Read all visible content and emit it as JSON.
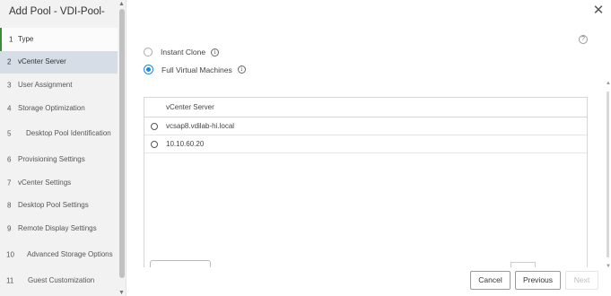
{
  "dialog": {
    "title": "Add Pool - VDI-Pool-"
  },
  "steps": [
    {
      "num": "1",
      "label": "Type"
    },
    {
      "num": "2",
      "label": "vCenter Server"
    },
    {
      "num": "3",
      "label": "User Assignment"
    },
    {
      "num": "4",
      "label": "Storage Optimization"
    },
    {
      "num": "5",
      "label": "Desktop Pool Identification"
    },
    {
      "num": "6",
      "label": "Provisioning Settings"
    },
    {
      "num": "7",
      "label": "vCenter Settings"
    },
    {
      "num": "8",
      "label": "Desktop Pool Settings"
    },
    {
      "num": "9",
      "label": "Remote Display Settings"
    },
    {
      "num": "10",
      "label": "Advanced Storage Options"
    },
    {
      "num": "11",
      "label": "Guest Customization"
    }
  ],
  "clone_type": {
    "options": [
      {
        "label": "Instant Clone",
        "selected": false
      },
      {
        "label": "Full Virtual Machines",
        "selected": true
      }
    ]
  },
  "grid": {
    "header": "vCenter Server",
    "rows": [
      {
        "name": "vcsap8.vdilab-hi.local"
      },
      {
        "name": "10.10.60.20"
      }
    ]
  },
  "footer": {
    "cancel": "Cancel",
    "previous": "Previous",
    "next": "Next"
  },
  "icons": {
    "close": "close-icon",
    "help": "help-icon",
    "info": "info-icon"
  },
  "colors": {
    "accent": "#1c8bd6",
    "active_step_bg": "#d6dde6",
    "completed_marker": "#3a8e3a"
  }
}
